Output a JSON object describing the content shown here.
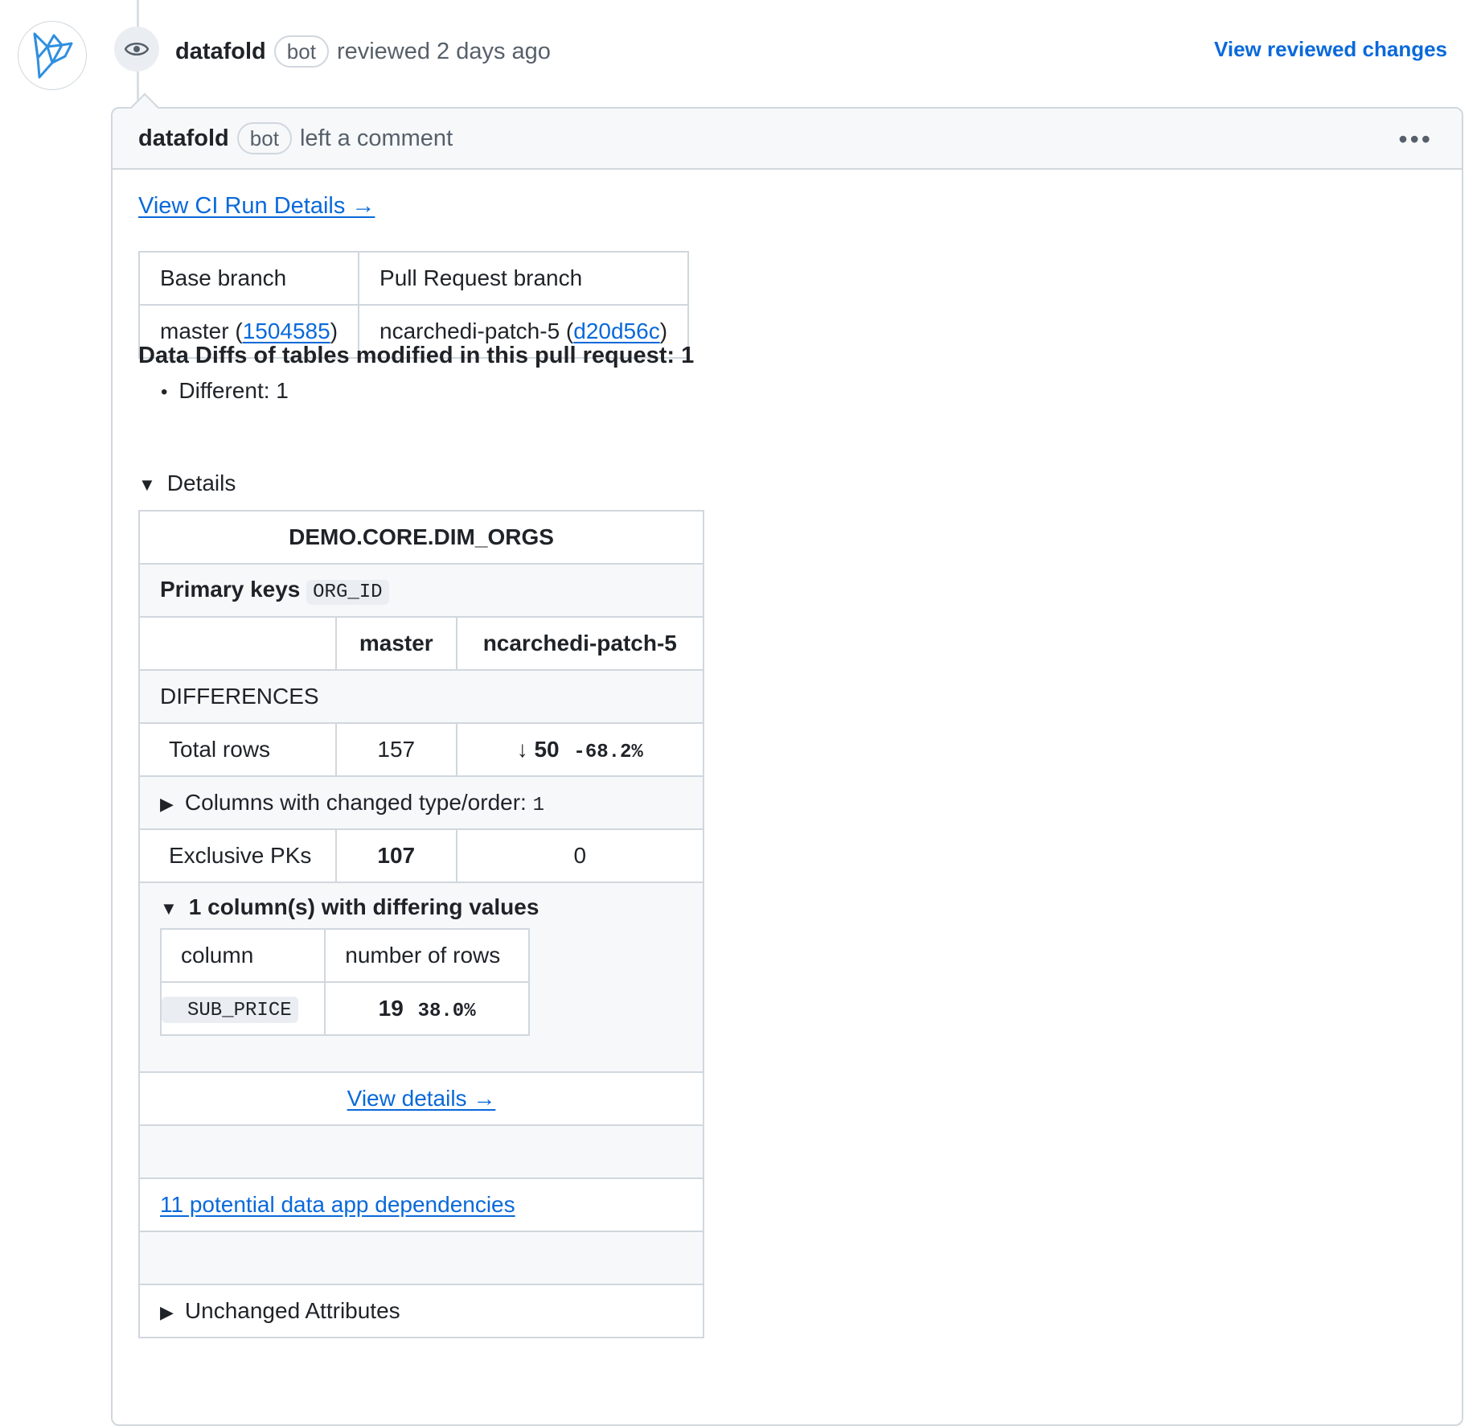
{
  "timeline": {
    "author": "datafold",
    "bot_label": "bot",
    "action": "reviewed 2 days ago",
    "view_reviewed_label": "View reviewed changes"
  },
  "comment": {
    "author": "datafold",
    "bot_label": "bot",
    "action": "left a comment",
    "more_icon": "kebab-horizontal-icon",
    "ci_link_label": "View CI Run Details →",
    "branches": {
      "base_header": "Base branch",
      "pr_header": "Pull Request branch",
      "base_name": "master",
      "base_sha": "1504585",
      "pr_name": "ncarchedi-patch-5",
      "pr_sha": "d20d56c"
    },
    "summary_title": "Data Diffs of tables modified in this pull request: 1",
    "summary_items": [
      "Different: 1"
    ],
    "details_label": "Details",
    "table": {
      "name": "DEMO.CORE.DIM_ORGS",
      "primary_keys_label": "Primary keys",
      "primary_key": "ORG_ID",
      "col_base": "master",
      "col_pr": "ncarchedi-patch-5",
      "differences_label": "DIFFERENCES",
      "total_rows_label": "Total rows",
      "total_rows_base": "157",
      "total_rows_pr": "↓ 50",
      "total_rows_pct": "-68.2%",
      "changed_columns_label": "Columns with changed type/order:",
      "changed_columns_count": "1",
      "exclusive_pks_label": "Exclusive PKs",
      "exclusive_pks_base": "107",
      "exclusive_pks_pr": "0",
      "differing_label": "1 column(s) with differing values",
      "inner_col_header": "column",
      "inner_rows_header": "number of rows",
      "inner_column": "SUB_PRICE",
      "inner_rows": "19",
      "inner_pct": "38.0%",
      "view_details_label": "View details →",
      "dependencies_label": "11 potential data app dependencies",
      "unchanged_label": "Unchanged Attributes"
    }
  }
}
